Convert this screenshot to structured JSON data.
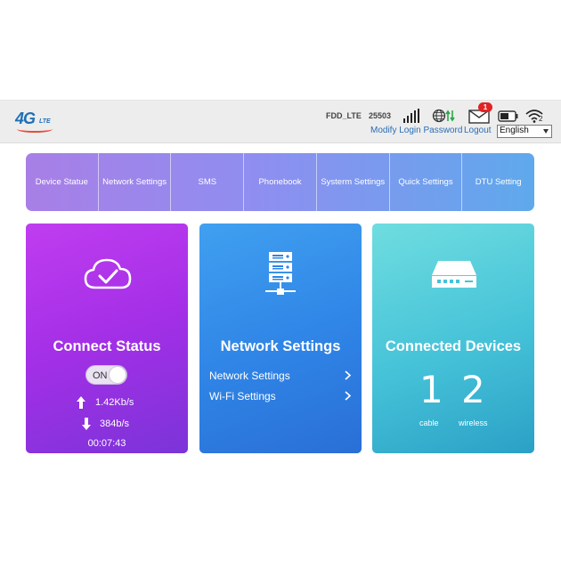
{
  "header": {
    "logo_main": "4G",
    "logo_sub": "LTE",
    "network_name": "FDD_LTE",
    "network_code": "25503",
    "mail_badge": "1",
    "wifi_clients": "2",
    "modify_password": "Modify Login Password",
    "logout": "Logout",
    "language": "English"
  },
  "nav": {
    "items": [
      "Device Statue",
      "Network Settings",
      "SMS",
      "Phonebook",
      "Systerm Settings",
      "Quick Settings",
      "DTU Setting"
    ]
  },
  "cards": {
    "status": {
      "title": "Connect Status",
      "toggle": "ON",
      "upload": "1.42Kb/s",
      "download": "384b/s",
      "duration": "00:07:43",
      "icon": "cloud-check-icon"
    },
    "network": {
      "title": "Network Settings",
      "links": [
        "Network Settings",
        "Wi-Fi Settings"
      ],
      "icon": "server-icon"
    },
    "devices": {
      "title": "Connected Devices",
      "cable_count": "1",
      "wireless_count": "2",
      "cable_label": "cable",
      "wireless_label": "wireless",
      "icon": "router-icon"
    }
  },
  "colors": {
    "status_card": "#a32fe6",
    "network_card": "#2f84e6",
    "devices_card": "#45c2d8",
    "link": "#2a6db5",
    "badge": "#e02424"
  }
}
